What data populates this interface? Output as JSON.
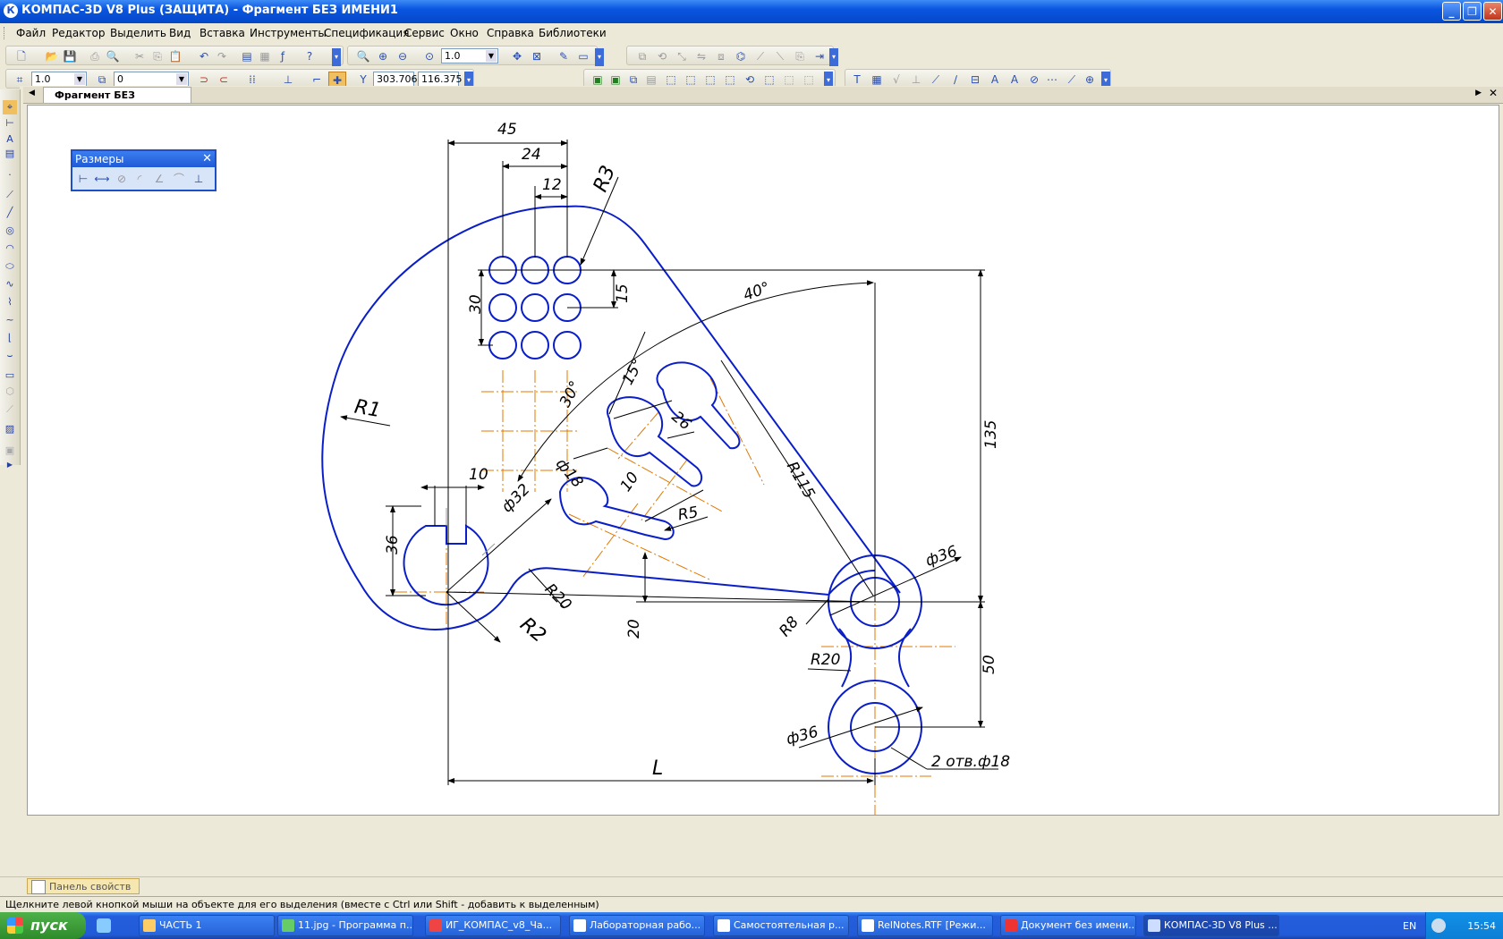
{
  "window": {
    "title": "КОМПАС-3D V8 Plus (ЗАЩИТА) - Фрагмент БЕЗ ИМЕНИ1",
    "app_icon": "К",
    "minimize": "_",
    "maximize": "❐",
    "close": "✕"
  },
  "menu": [
    "Файл",
    "Редактор",
    "Выделить",
    "Вид",
    "Вставка",
    "Инструменты",
    "Спецификация",
    "Сервис",
    "Окно",
    "Справка",
    "Библиотеки"
  ],
  "toolbar": {
    "zoom_value": "1.0",
    "step_value": "1.0",
    "layer_value": "0",
    "coord_x": "303.706",
    "coord_y": "116.375"
  },
  "document": {
    "tab_label": "Фрагмент БЕЗ ИМЕНИ1"
  },
  "palette": {
    "title": "Размеры",
    "close": "✕"
  },
  "drawing": {
    "dims": {
      "d45": "45",
      "d24": "24",
      "d12": "12",
      "r3": "R3",
      "d15": "15",
      "d30": "30",
      "a40": "40°",
      "a15": "15°",
      "a30": "30°",
      "d26": "26",
      "phi18": "ф18",
      "d10a": "10",
      "d10b": "10",
      "phi32": "ф32",
      "r5": "R5",
      "r115": "R115",
      "d135": "135",
      "r1": "R1",
      "d36": "36",
      "r20a": "R20",
      "r2": "R2",
      "d20": "20",
      "r8": "R8",
      "phi36a": "ф36",
      "r20b": "R20",
      "d50": "50",
      "phi36b": "ф36",
      "holes": "2 отв.ф18",
      "L": "L"
    },
    "line_color": "#0a1ec8",
    "center_color": "#e07800"
  },
  "property_panel": {
    "label": "Панель свойств"
  },
  "status": {
    "text": "Щелкните левой кнопкой мыши на объекте для его выделения (вместе с Ctrl или Shift - добавить к выделенным)"
  },
  "taskbar": {
    "start": "пуск",
    "tasks": [
      {
        "label": "ЧАСТЬ 1"
      },
      {
        "label": "11.jpg - Программа п..."
      },
      {
        "label": "ИГ_КОМПАС_v8_Ча..."
      },
      {
        "label": "Лабораторная рабо..."
      },
      {
        "label": "Самостоятельная р..."
      },
      {
        "label": "RelNotes.RTF [Режи..."
      },
      {
        "label": "Документ без имени..."
      },
      {
        "label": "КОМПАС-3D V8 Plus ..."
      }
    ],
    "lang": "EN",
    "clock": "15:54"
  }
}
